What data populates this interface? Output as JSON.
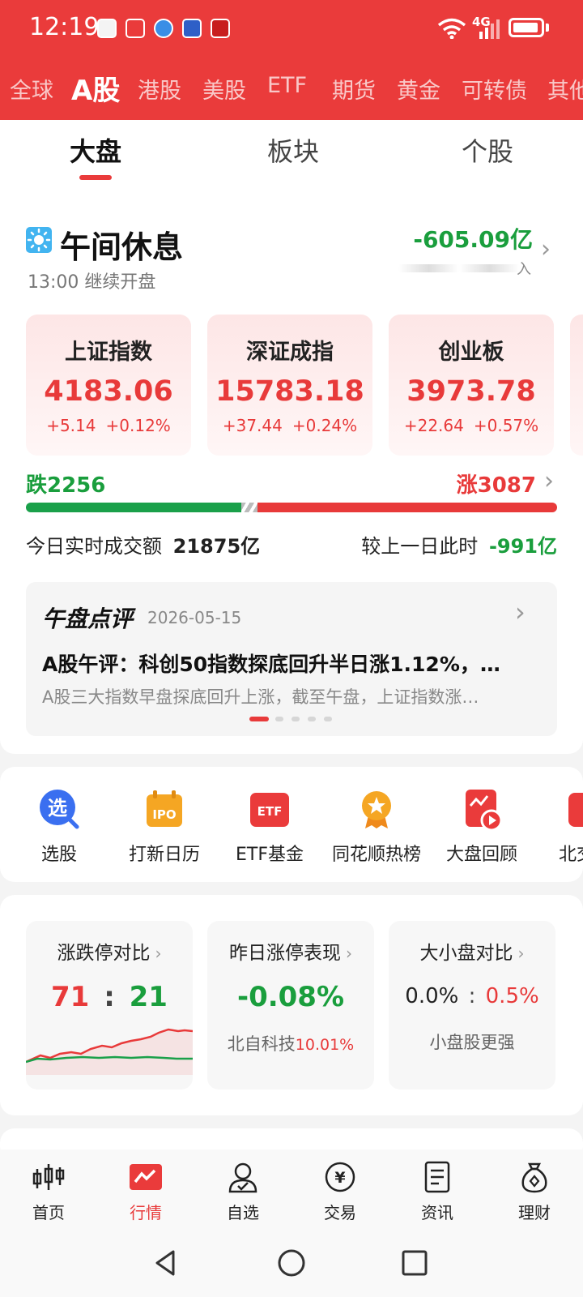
{
  "status_bar": {
    "time": "12:19",
    "network": "4G"
  },
  "market_tabs": [
    "全球",
    "A股",
    "港股",
    "美股",
    "ETF",
    "期货",
    "黄金",
    "可转债",
    "其他"
  ],
  "active_market": "A股",
  "sub_tabs": [
    "大盘",
    "板块",
    "个股"
  ],
  "session": {
    "title": "午间休息",
    "subtitle": "13:00 继续开盘",
    "net_flow": "-605.09亿",
    "net_flow_label": "入"
  },
  "indices": [
    {
      "name": "上证指数",
      "value": "4183.06",
      "change": "+5.14",
      "pct": "+0.12%"
    },
    {
      "name": "深证成指",
      "value": "15783.18",
      "change": "+37.44",
      "pct": "+0.24%"
    },
    {
      "name": "创业板",
      "value": "3973.78",
      "change": "+22.64",
      "pct": "+0.57%"
    }
  ],
  "breadth": {
    "down_label": "跌2256",
    "up_label": "涨3087",
    "up_fraction": 0.578
  },
  "turnover": {
    "label": "今日实时成交额",
    "value": "21875亿",
    "compare_label": "较上一日此时",
    "compare_value": "-991亿"
  },
  "news": {
    "brand": "午盘点评",
    "date": "2026-05-15",
    "headline": "A股午评：科创50指数探底回升半日涨1.12%，…",
    "summary": "A股三大指数早盘探底回升上涨，截至午盘，上证指数涨…",
    "page_count": 5,
    "active_page": 0
  },
  "quick_links": [
    {
      "label": "选股",
      "icon": "select-stock-icon",
      "glyph": "选"
    },
    {
      "label": "打新日历",
      "icon": "ipo-calendar-icon",
      "glyph": "IPO"
    },
    {
      "label": "ETF基金",
      "icon": "etf-fund-icon",
      "glyph": "ETF"
    },
    {
      "label": "同花顺热榜",
      "icon": "hot-list-icon",
      "glyph": "★"
    },
    {
      "label": "大盘回顾",
      "icon": "market-review-icon",
      "glyph": ""
    },
    {
      "label": "北交",
      "icon": "bse-icon",
      "glyph": ""
    }
  ],
  "stats": {
    "limit_compare": {
      "title": "涨跌停对比",
      "up": "71",
      "sep": ":",
      "down": "21"
    },
    "yesterday_limit": {
      "title": "昨日涨停表现",
      "value": "-0.08%",
      "top_stock": "北自科技",
      "top_pct": "10.01%"
    },
    "cap_compare": {
      "title": "大小盘对比",
      "large": "0.0%",
      "sep": ":",
      "small": "0.5%",
      "note": "小盘股更强"
    }
  },
  "bottom_tabs": [
    "首页",
    "行情",
    "自选",
    "交易",
    "资讯",
    "理财"
  ],
  "active_bottom_tab": "行情",
  "colors": {
    "brand": "#ea3b3b",
    "up": "#e83a3a",
    "down": "#1a9e3d"
  }
}
